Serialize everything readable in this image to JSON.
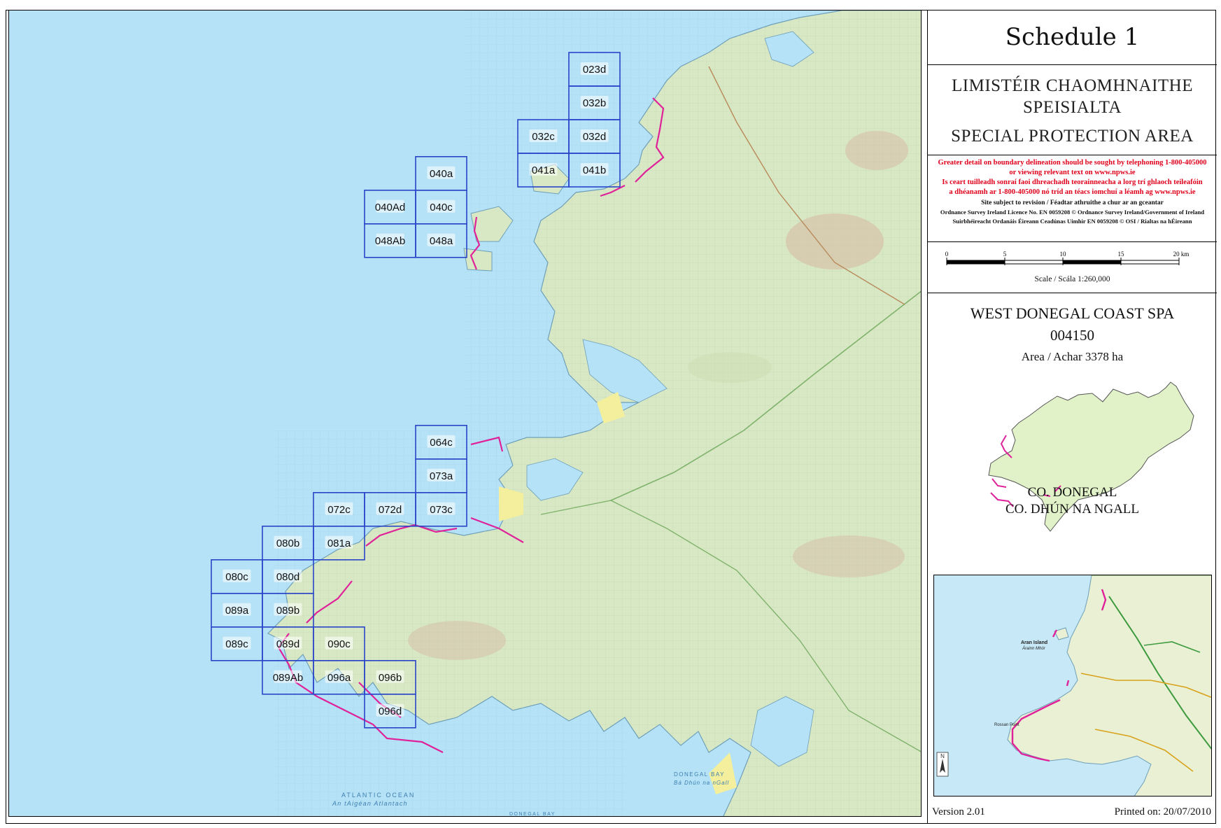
{
  "title_block": {
    "schedule": "Schedule 1",
    "designation_irish_line1": "LIMISTÉIR CHAOMHNAITHE",
    "designation_irish_line2": "SPEISIALTA",
    "designation_english": "SPECIAL PROTECTION AREA"
  },
  "notes": {
    "red_lines": [
      "Greater detail on boundary delineation should be sought by telephoning 1-800-405000",
      "or viewing relevant text on www.npws.ie",
      "Is ceart tuilleadh sonraí faoi dhreachadh teorainneacha a lorg trí ghlaoch teileafóin",
      "a dhéanamh ar 1-800-405000 nó tríd an téacs iomchuí a léamh ag www.npws.ie"
    ],
    "black_lines": [
      "Site subject to revision / Féadtar athruithe a chur ar an gceantar",
      "Ordnance Survey Ireland Licence No. EN 0059208 © Ordnance Survey Ireland/Government of Ireland",
      "Suirbhéireacht Ordanáis Éireann Ceadúnas Uimhir EN 0059208 © OSI / Rialtas na hÉireann"
    ]
  },
  "scale_bar": {
    "ticks": [
      "0",
      "5",
      "10",
      "15",
      "20 km"
    ],
    "caption": "Scale / Scála 1:260,000"
  },
  "site": {
    "name": "WEST DONEGAL COAST SPA",
    "code": "004150",
    "area": "Area / Achar 3378 ha",
    "county_english": "CO. DONEGAL",
    "county_irish": "CO. DHÚN NA NGALL"
  },
  "footer": {
    "version": "Version 2.01",
    "printed": "Printed on: 20/07/2010"
  },
  "map_tiles": [
    "023d",
    "032b",
    "032c",
    "032d",
    "041a",
    "041b",
    "040a",
    "040Ad",
    "040c",
    "048Ab",
    "048a",
    "064c",
    "073a",
    "072c",
    "072d",
    "073c",
    "080b",
    "081a",
    "080c",
    "080d",
    "089a",
    "089b",
    "089c",
    "089d",
    "090c",
    "089Ab",
    "096a",
    "096b",
    "096d"
  ],
  "map_labels": {
    "ocean_english": "ATLANTIC OCEAN",
    "ocean_irish": "An tAigéan Atlantach",
    "bay_english": "DONEGAL BAY",
    "bay_irish": "Bá Dhún na nGall",
    "island_english": "Aran Island",
    "island_irish": "Árainn Mhór",
    "bay_lower": "DONEGAL BAY",
    "locality": "Rossan Point"
  },
  "colors": {
    "sea": "#b5e2f7",
    "land": "#d8e8c4",
    "tile_border": "#2845c8",
    "spa_boundary": "#e0229a",
    "notes_red": "#e0001b",
    "county_fill": "#e1f2c8"
  }
}
